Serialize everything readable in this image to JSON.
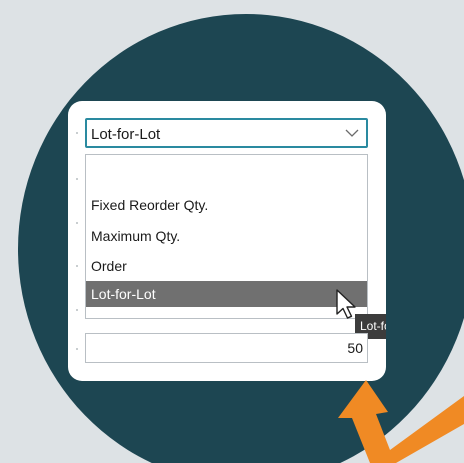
{
  "reordering_policy": {
    "selected_value": "Lot-for-Lot",
    "dropdown_icon": "chevron-down-icon",
    "options": [
      {
        "label": "",
        "selected": false
      },
      {
        "label": "Fixed Reorder Qty.",
        "selected": false
      },
      {
        "label": "Maximum Qty.",
        "selected": false
      },
      {
        "label": "Order",
        "selected": false
      },
      {
        "label": "Lot-for-Lot",
        "selected": true
      }
    ]
  },
  "tooltip": {
    "text": "Lot-for-Lot"
  },
  "quantity_field": {
    "value": "50"
  },
  "colors": {
    "background": "#dde2e5",
    "circle": "#1d4652",
    "focus_border": "#2a8aa0",
    "selected_row": "#707070",
    "arrow": "#f08a24"
  }
}
